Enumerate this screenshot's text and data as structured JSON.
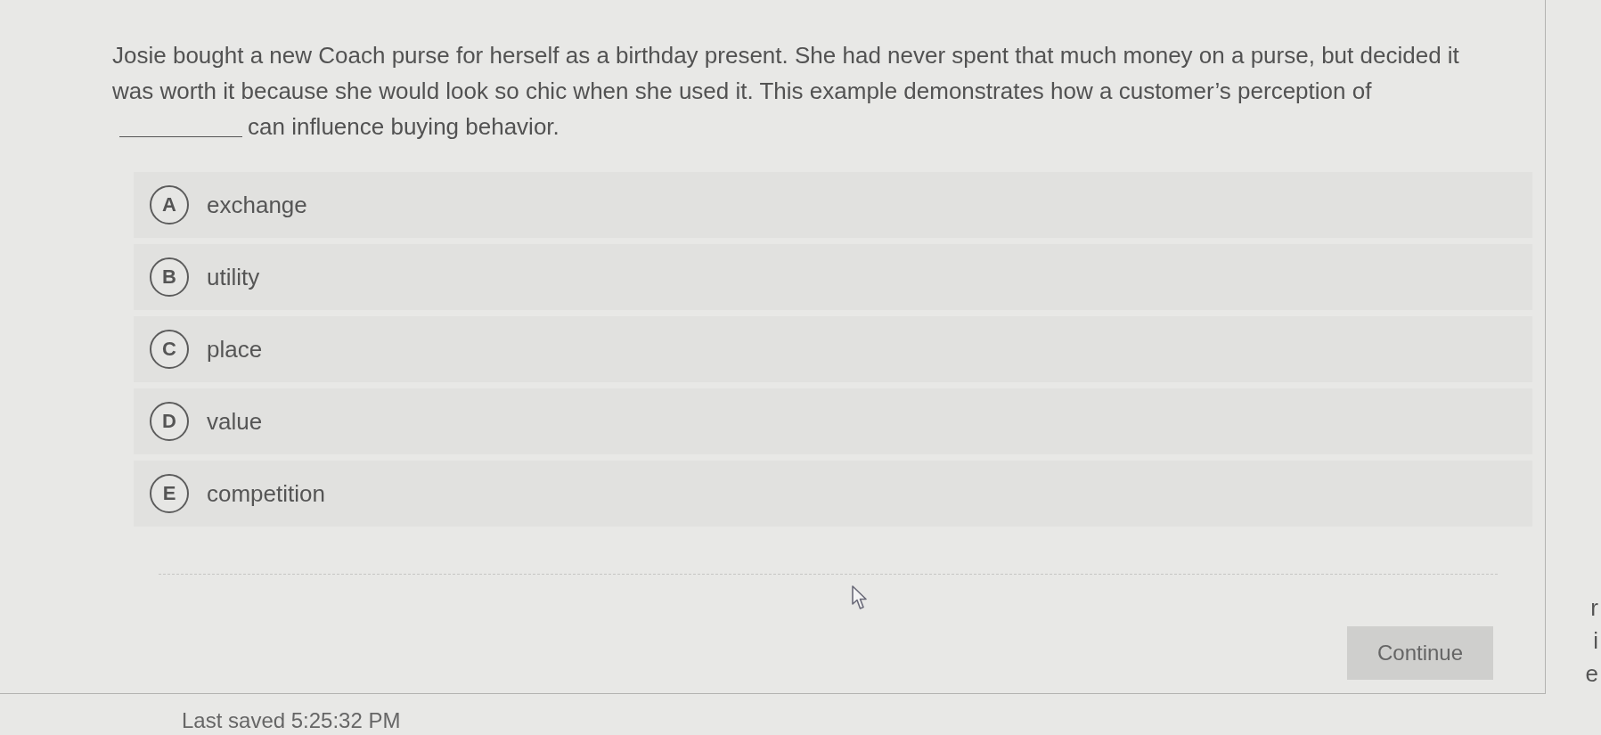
{
  "question": {
    "text": "Josie bought a new Coach purse for herself as a birthday present. She had never spent that much money on a purse, but decided it was worth it because she would look so chic when she used it. This example demonstrates how a customer’s perception of",
    "text_after_blank": "can influence buying behavior."
  },
  "options": [
    {
      "letter": "A",
      "label": "exchange",
      "selected": false
    },
    {
      "letter": "B",
      "label": "utility",
      "selected": false
    },
    {
      "letter": "C",
      "label": "place",
      "selected": false
    },
    {
      "letter": "D",
      "label": "value",
      "selected": false
    },
    {
      "letter": "E",
      "label": "competition",
      "selected": false
    }
  ],
  "continue_button": {
    "label": "Continue"
  },
  "status": {
    "last_saved": "Last saved 5:25:32 PM"
  },
  "side_panel": {
    "text_fragments": [
      "r",
      "i",
      "e"
    ]
  }
}
